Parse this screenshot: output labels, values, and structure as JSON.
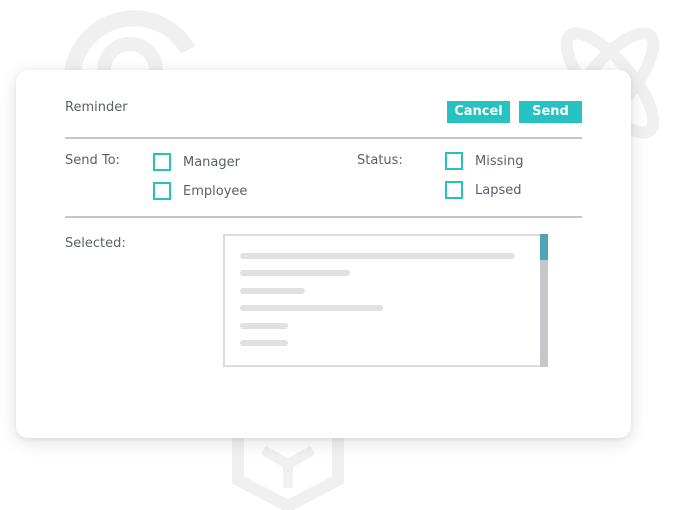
{
  "dialog": {
    "title": "Reminder",
    "cancel_label": "Cancel",
    "send_label": "Send"
  },
  "send_to": {
    "label": "Send To:",
    "options": [
      {
        "label": "Manager",
        "checked": false
      },
      {
        "label": "Employee",
        "checked": false
      }
    ]
  },
  "status": {
    "label": "Status:",
    "options": [
      {
        "label": "Missing",
        "checked": false
      },
      {
        "label": "Lapsed",
        "checked": false
      }
    ]
  },
  "selected": {
    "label": "Selected:"
  },
  "colors": {
    "accent": "#26c2c2",
    "scroll_thumb": "#4fa3b5",
    "divider": "#c4c6c9",
    "text": "#5a5f6b"
  }
}
